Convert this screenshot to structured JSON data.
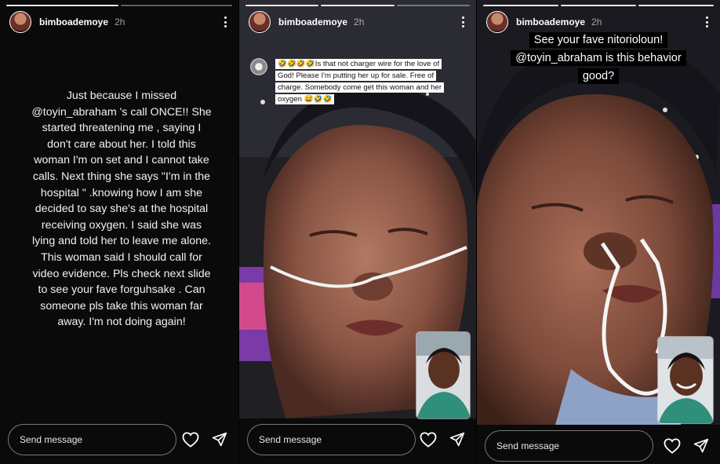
{
  "stories": [
    {
      "username": "bimboademoye",
      "time": "2h",
      "text": "Just because I missed @toyin_abraham 's call ONCE!! She started threatening me , saying I don't care about her. I told this woman I'm on set and I cannot take calls. Next thing she says \"I'm in the hospital \" .knowing how I am she decided to say she's at the hospital receiving oxygen. I said she was lying and told her to leave me alone. This woman said I should call for video evidence. Pls check next slide to see your fave forguhsake . Can someone pls take this woman far away. I'm not doing again!",
      "send_placeholder": "Send message"
    },
    {
      "username": "bimboademoye",
      "time": "2h",
      "caption": "🤣🤣🤣🤣Is that not charger wire for the love of God! Please I'm putting her up for sale. Free of charge. Somebody come get this woman and her oxygen 😅🤣🤣",
      "send_placeholder": "Send message"
    },
    {
      "username": "bimboademoye",
      "time": "2h",
      "caption": "See your fave nitorioloun! @toyin_abraham is this behavior good?",
      "send_placeholder": "Send message"
    }
  ],
  "icons": {
    "like": "heart-icon",
    "share": "paper-plane-icon",
    "menu": "more-vertical-icon"
  },
  "colors": {
    "background": "#0a0a0a",
    "text": "#ffffff"
  }
}
